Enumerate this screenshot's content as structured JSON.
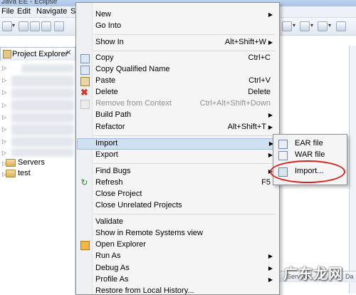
{
  "window": {
    "title": "Java EE - Eclipse"
  },
  "menubar": [
    "File",
    "Edit",
    "Navigate",
    "Se"
  ],
  "project_explorer": {
    "tab_label": "Project Explorer",
    "items": [
      "Servers",
      "test"
    ]
  },
  "context_menu": {
    "items": [
      {
        "label": "New",
        "submenu": true
      },
      {
        "label": "Go Into"
      },
      {
        "label": "Show In",
        "shortcut": "Alt+Shift+W",
        "submenu": true
      },
      {
        "label": "Copy",
        "shortcut": "Ctrl+C",
        "icon": "copy-icon"
      },
      {
        "label": "Copy Qualified Name",
        "icon": "copy-qualified-icon"
      },
      {
        "label": "Paste",
        "shortcut": "Ctrl+V",
        "icon": "paste-icon"
      },
      {
        "label": "Delete",
        "shortcut": "Delete",
        "icon": "delete-icon"
      },
      {
        "label": "Remove from Context",
        "shortcut": "Ctrl+Alt+Shift+Down",
        "disabled": true,
        "icon": "remove-context-icon"
      },
      {
        "label": "Build Path",
        "submenu": true
      },
      {
        "label": "Refactor",
        "shortcut": "Alt+Shift+T",
        "submenu": true
      },
      {
        "label": "Import",
        "submenu": true,
        "highlighted": true
      },
      {
        "label": "Export",
        "submenu": true
      },
      {
        "label": "Find Bugs",
        "submenu": true
      },
      {
        "label": "Refresh",
        "shortcut": "F5",
        "icon": "refresh-icon"
      },
      {
        "label": "Close Project"
      },
      {
        "label": "Close Unrelated Projects"
      },
      {
        "label": "Validate"
      },
      {
        "label": "Show in Remote Systems view"
      },
      {
        "label": "Open Explorer",
        "icon": "open-explorer-icon"
      },
      {
        "label": "Run As",
        "submenu": true
      },
      {
        "label": "Debug As",
        "submenu": true
      },
      {
        "label": "Profile As",
        "submenu": true
      },
      {
        "label": "Restore from Local History..."
      }
    ]
  },
  "import_submenu": {
    "items": [
      {
        "label": "EAR file",
        "icon": "ear-file-icon"
      },
      {
        "label": "WAR file",
        "icon": "war-file-icon"
      },
      {
        "label": "Import...",
        "icon": "import-wizard-icon"
      }
    ]
  },
  "bottom_tabs": {
    "servers": "Servers",
    "data": "Da"
  },
  "watermark": "广东龙网",
  "colors": {
    "highlight": "#cfe0f5",
    "annotation_circle": "#d0261f"
  }
}
